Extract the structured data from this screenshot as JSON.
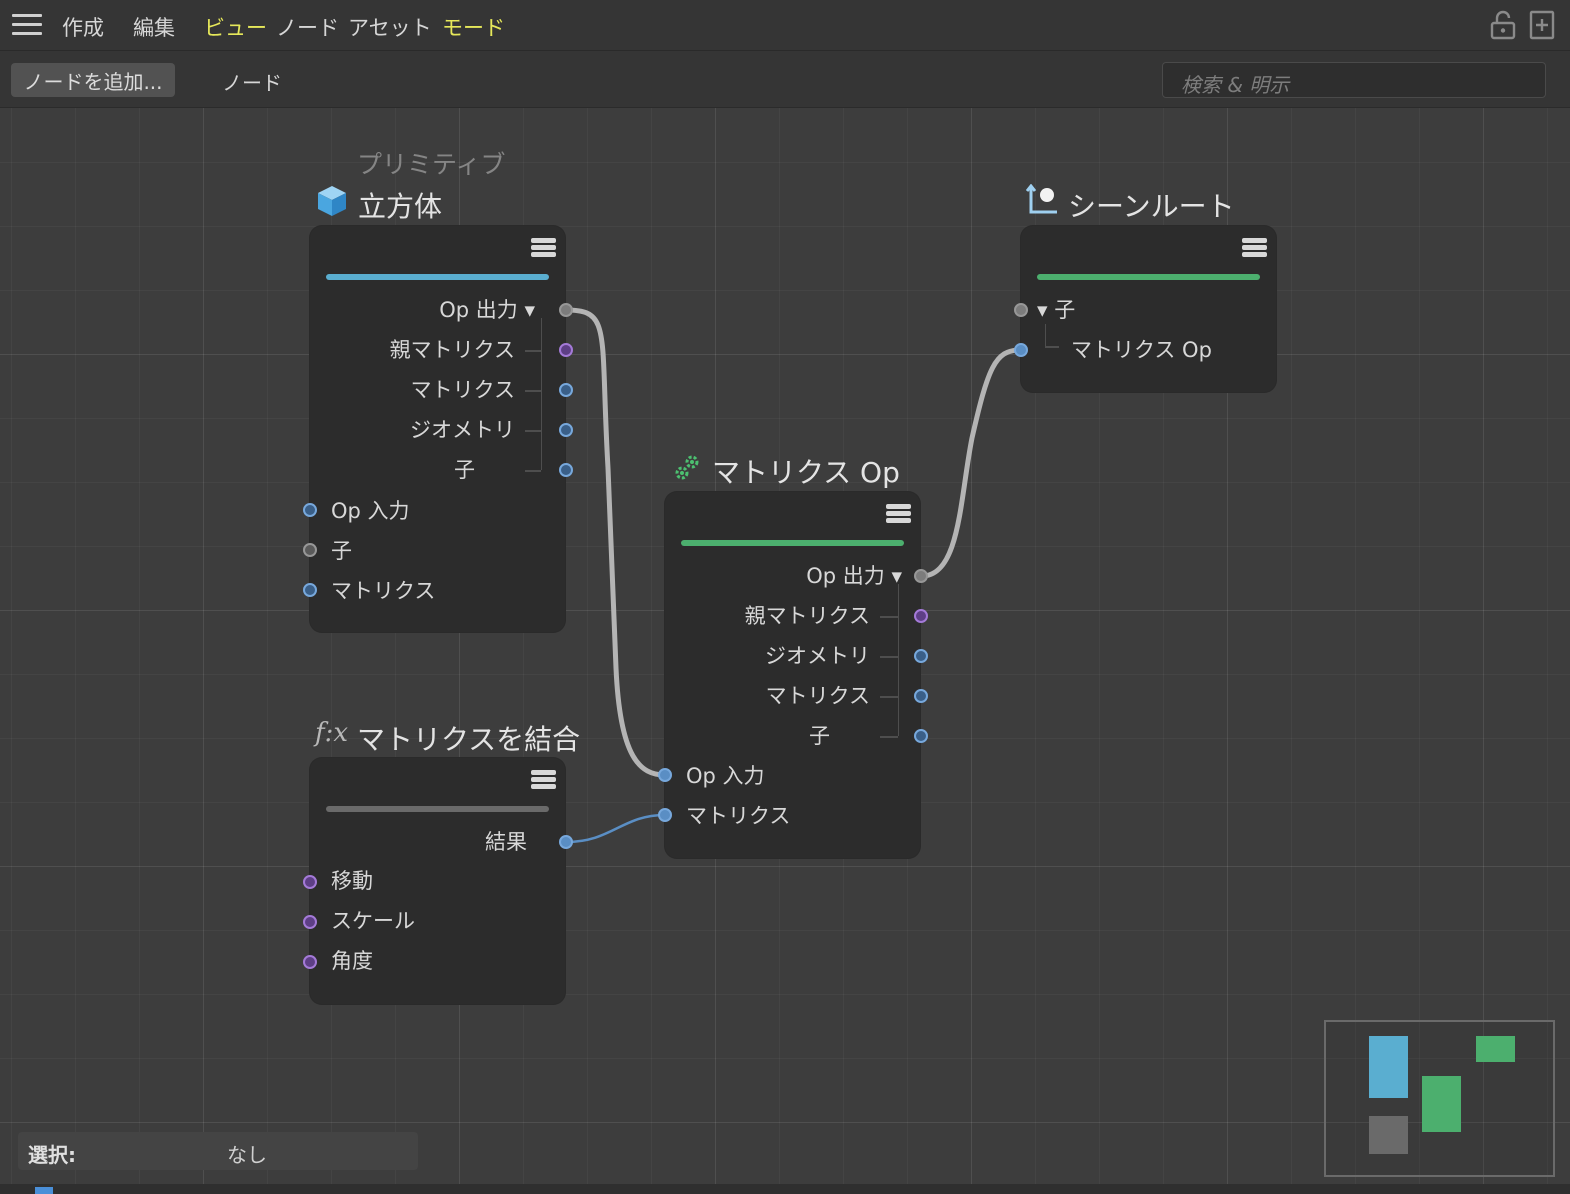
{
  "menu": {
    "items": [
      "作成",
      "編集",
      "ビュー",
      "ノード",
      "アセット",
      "モード"
    ]
  },
  "toolbar": {
    "add_node_label": "ノードを追加...",
    "node_tab_label": "ノード",
    "search_placeholder": "検索 & 明示"
  },
  "nodes": {
    "cube": {
      "category": "プリミティブ",
      "title": "立方体",
      "bar_color": "#5aaed0",
      "outputs": [
        "Op 出力 ▾",
        "親マトリクス",
        "マトリクス",
        "ジオメトリ",
        "子"
      ],
      "inputs": [
        "Op 入力",
        "子",
        "マトリクス"
      ]
    },
    "combine": {
      "title_prefix": "f:x",
      "title": "マトリクスを結合",
      "bar_color": "#6a6a6a",
      "outputs": [
        "結果"
      ],
      "inputs": [
        "移動",
        "スケール",
        "角度"
      ]
    },
    "matrix_op": {
      "title": "マトリクス Op",
      "bar_color": "#4caf6e",
      "outputs": [
        "Op 出力 ▾",
        "親マトリクス",
        "ジオメトリ",
        "マトリクス",
        "子"
      ],
      "inputs": [
        "Op 入力",
        "マトリクス"
      ]
    },
    "scene_root": {
      "title": "シーンルート",
      "bar_color": "#4caf6e",
      "inputs": [
        "▾ 子",
        "マトリクス Op"
      ]
    }
  },
  "status": {
    "label": "選択:",
    "value": "なし"
  },
  "colors": {
    "accent_yellow": "#e6e85a",
    "port_blue": "#5a8ec4",
    "port_purple": "#8a5fc0",
    "port_grey": "#7c7c7c",
    "wire": "#b4b4b4",
    "wire_blue": "#5a8ec4"
  },
  "icons": [
    "hamburger-icon",
    "lock-icon",
    "new-panel-icon",
    "cube-icon",
    "function-icon",
    "gears-icon",
    "scene-root-icon",
    "node-menu-icon"
  ]
}
